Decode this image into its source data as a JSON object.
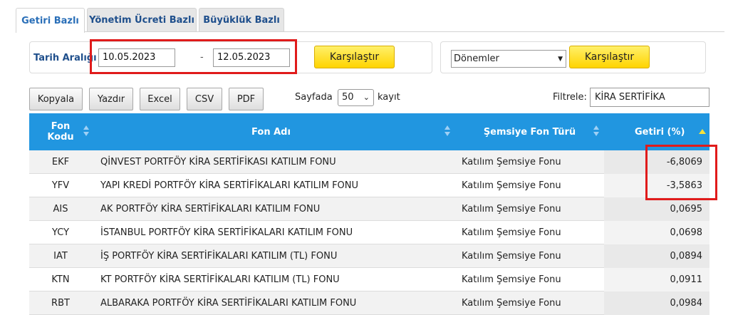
{
  "tabs": [
    {
      "label": "Getiri Bazlı",
      "active": true
    },
    {
      "label": "Yönetim Ücreti Bazlı",
      "active": false
    },
    {
      "label": "Büyüklük Bazlı",
      "active": false
    }
  ],
  "date_range": {
    "label": "Tarih Aralığı",
    "start": "10.05.2023",
    "separator": "-",
    "end": "12.05.2023",
    "compare_label": "Karşılaştır"
  },
  "period": {
    "selected": "Dönemler",
    "compare_label": "Karşılaştır"
  },
  "toolbar": {
    "copy": "Kopyala",
    "print": "Yazdır",
    "excel": "Excel",
    "csv": "CSV",
    "pdf": "PDF",
    "page_size_prefix": "Sayfada",
    "page_size": "50",
    "page_size_suffix": "kayıt",
    "filter_label": "Filtrele:",
    "filter_value": "KİRA SERTİFİKA"
  },
  "table": {
    "columns": {
      "code": "Fon Kodu",
      "name": "Fon Adı",
      "type": "Şemsiye Fon Türü",
      "return": "Getiri (%)"
    },
    "rows": [
      {
        "code": "EKF",
        "name": "QİNVEST PORTFÖY KİRA SERTİFİKASI KATILIM FONU",
        "type": "Katılım Şemsiye Fonu",
        "return": "-6,8069"
      },
      {
        "code": "YFV",
        "name": "YAPI KREDİ PORTFÖY KİRA SERTİFİKALARI KATILIM FONU",
        "type": "Katılım Şemsiye Fonu",
        "return": "-3,5863"
      },
      {
        "code": "AIS",
        "name": "AK PORTFÖY KİRA SERTİFİKALARI KATILIM FONU",
        "type": "Katılım Şemsiye Fonu",
        "return": "0,0695"
      },
      {
        "code": "YCY",
        "name": "İSTANBUL PORTFÖY KİRA SERTİFİKALARI KATILIM FONU",
        "type": "Katılım Şemsiye Fonu",
        "return": "0,0698"
      },
      {
        "code": "IAT",
        "name": "İŞ PORTFÖY KİRA SERTİFİKALARI KATILIM (TL) FONU",
        "type": "Katılım Şemsiye Fonu",
        "return": "0,0894"
      },
      {
        "code": "KTN",
        "name": "KT PORTFÖY KİRA SERTİFİKALARI KATILIM (TL) FONU",
        "type": "Katılım Şemsiye Fonu",
        "return": "0,0911"
      },
      {
        "code": "RBT",
        "name": "ALBARAKA PORTFÖY KİRA SERTİFİKALARI KATILIM FONU",
        "type": "Katılım Şemsiye Fonu",
        "return": "0,0984"
      }
    ]
  },
  "colors": {
    "header_blue": "#2196e0",
    "highlight_red": "#e01b1b",
    "button_yellow": "#ffd400"
  }
}
